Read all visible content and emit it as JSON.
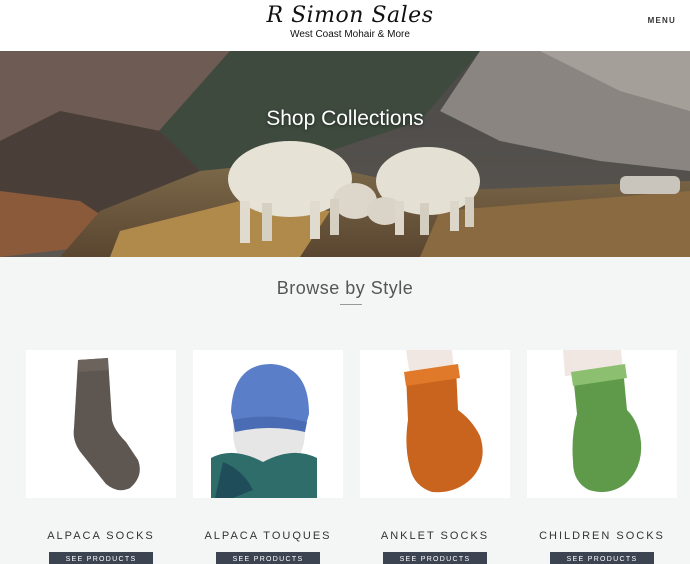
{
  "header": {
    "brand": "R Simon Sales",
    "tagline": "West Coast Mohair & More",
    "menu_label": "MENU"
  },
  "hero": {
    "title": "Shop Collections"
  },
  "section": {
    "title": "Browse by Style"
  },
  "products": [
    {
      "label": "ALPACA SOCKS",
      "button": "SEE PRODUCTS",
      "color": "#5e5650"
    },
    {
      "label": "ALPACA TOUQUES",
      "button": "SEE PRODUCTS",
      "color": "#5b7ec9"
    },
    {
      "label": "ANKLET SOCKS",
      "button": "SEE PRODUCTS",
      "color": "#c9641f"
    },
    {
      "label": "CHILDREN SOCKS",
      "button": "SEE PRODUCTS",
      "color": "#5e9a4a"
    }
  ]
}
